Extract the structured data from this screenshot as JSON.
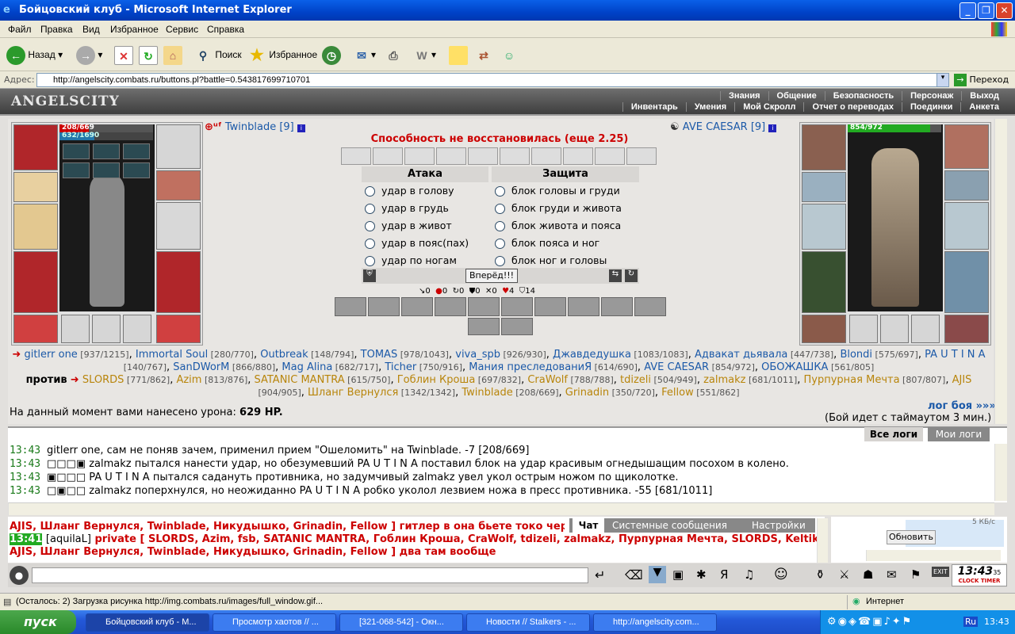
{
  "window": {
    "title": "Бойцовский клуб - Microsoft Internet Explorer"
  },
  "menu": [
    "Файл",
    "Правка",
    "Вид",
    "Избранное",
    "Сервис",
    "Справка"
  ],
  "toolbar": {
    "back": "Назад",
    "search": "Поиск",
    "favorites": "Избранное"
  },
  "address": {
    "label": "Адрес:",
    "url": "http://angelscity.combats.ru/buttons.pl?battle=0.543817699710701",
    "go": "Переход"
  },
  "game": {
    "logo": "ANGELSCITY",
    "nav1": [
      "Знания",
      "Общение",
      "Безопасность",
      "Персонаж",
      "Выход"
    ],
    "nav2": [
      "Инвентарь",
      "Умения",
      "Мой Скролл",
      "Отчет о переводах",
      "Поединки",
      "Анкета"
    ],
    "left_player": {
      "name": "Twinblade [9]",
      "hp": "208/669",
      "mana": "632/1690",
      "hp_frac": 0.31,
      "mana_frac": 0.37
    },
    "right_player": {
      "name": "AVE CAESAR [9]",
      "hp": "854/972",
      "hp_frac": 0.88
    },
    "ability_msg": "Способность не восстановилась (еще 2.25)",
    "attack_title": "Атака",
    "defense_title": "Защита",
    "attacks": [
      "удар в голову",
      "удар в грудь",
      "удар в живот",
      "удар в пояс(пах)",
      "удар по ногам"
    ],
    "blocks": [
      "блок головы и груди",
      "блок груди и живота",
      "блок живота и пояса",
      "блок пояса и ног",
      "блок ног и головы"
    ],
    "forward_button": "Вперёд!!!",
    "counters": [
      "0",
      "0",
      "0",
      "0",
      "0",
      "4",
      "14"
    ],
    "team1": [
      [
        "gitlerr one",
        "[937/1215]"
      ],
      [
        "Immortal Soul",
        "[280/770]"
      ],
      [
        "Outbreak",
        "[148/794]"
      ],
      [
        "TOMAS",
        "[978/1043]"
      ],
      [
        "viva_spb",
        "[926/930]"
      ],
      [
        "Джавдедушка",
        "[1083/1083]"
      ],
      [
        "Адвакат дьявала",
        "[447/738]"
      ],
      [
        "Blondi",
        "[575/697]"
      ],
      [
        "PA U T I N A",
        "[140/767]"
      ],
      [
        "SanDWorM",
        "[866/880]"
      ],
      [
        "Mag Alina",
        "[682/717]"
      ],
      [
        "Ticher",
        "[750/916]"
      ],
      [
        "Мания преследованиЯ",
        "[614/690]"
      ],
      [
        "AVE CAESAR",
        "[854/972]"
      ],
      [
        "ОБОЖАШКА",
        "[561/805]"
      ]
    ],
    "vs_label": "против",
    "team2": [
      [
        "SLORDS",
        "[771/862]"
      ],
      [
        "Azim",
        "[813/876]"
      ],
      [
        "SATANIC MANTRA",
        "[615/750]"
      ],
      [
        "Гоблин Кроша",
        "[697/832]"
      ],
      [
        "CraWolf",
        "[788/788]"
      ],
      [
        "tdizeli",
        "[504/949]"
      ],
      [
        "zalmakz",
        "[681/1011]"
      ],
      [
        "Пурпурная Мечта",
        "[807/807]"
      ],
      [
        "AJIS",
        "[904/905]"
      ],
      [
        "Шланг Вернулся",
        "[1342/1342]"
      ],
      [
        "Twinblade",
        "[208/669]"
      ],
      [
        "Grinadin",
        "[350/720]"
      ],
      [
        "Fellow",
        "[551/862]"
      ]
    ],
    "damage_prefix": "На данный момент вами нанесено урона:",
    "damage_value": "629 HP.",
    "log_link": "лог боя »»»",
    "timeout_text": "(Бой идет с таймаутом 3 мин.)",
    "log_tabs": [
      "Все логи",
      "Мои логи"
    ],
    "log": [
      {
        "time": "13:43",
        "text": "gitlerr one, сам не поняв зачем, применил прием \"Ошеломить\" на Twinblade. -7 [208/669]"
      },
      {
        "time": "13:43",
        "text": "□□□▣ zalmakz пытался нанести удар, но обезумевший PA U T I N A поставил блок на удар красивым огнедышащим посохом в колено."
      },
      {
        "time": "13:43",
        "text": "▣□□□ PA U T I N A пытался садануть противника, но задумчивый zalmakz увел укол острым ножом по щиколотке."
      },
      {
        "time": "13:43",
        "text": "□▣□□ zalmakz поперхнулся, но неожиданно PA U T I N A робко уколол лезвием ножа в пресс противника. -55 [681/1011]"
      }
    ],
    "chat_tabs": [
      "Чат",
      "Системные сообщения",
      "Настройки"
    ],
    "chat": [
      {
        "text": "AJIS, Шланг Вернулся, Twinblade, Никудышко, Grinadin, Fellow ] гитлер в она бьете токо через п"
      },
      {
        "time": "13:41",
        "user": "[aquilaL]",
        "text": "private [ SLORDS, Azim, fsb, SATANIC MANTRA, Гоблин Кроша, CraWolf, tdizeli, zalmakz, Пурпурная Мечта, SLORDS, Keltik,"
      },
      {
        "text": "AJIS, Шланг Вернулся, Twinblade, Никудышко, Grinadin, Fellow ] два там вообще"
      }
    ],
    "refresh": "Обновить",
    "online_size": "5 КБ/с",
    "clock": "13:43",
    "clock_sec": "35",
    "clock_label": "CLOCK TIMER"
  },
  "status": {
    "text": "(Осталось: 2) Загрузка рисунка http://img.combats.ru/images/full_window.gif...",
    "zone": "Интернет"
  },
  "taskbar": {
    "start": "пуск",
    "tasks": [
      "Бойцовский клуб - М...",
      "Просмотр хаотов // ...",
      "[321-068-542] - Окн...",
      "Новости // Stalkers - ...",
      "http://angelscity.com..."
    ],
    "lang": "Ru",
    "time": "13:43"
  },
  "colors": {
    "accent_red": "#cc1111",
    "team1": "#1b59a8",
    "team2": "#b8850b"
  }
}
